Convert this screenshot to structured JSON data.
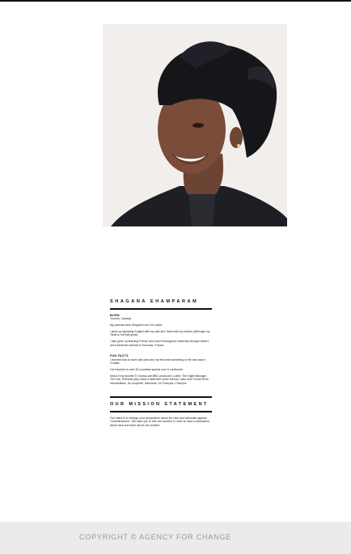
{
  "profile": {
    "name": "SHAGANA EHAMPARAM",
    "born": {
      "label": "BORN",
      "lines": [
        "Toronto, Canada.",
        "My parents were refugees from Sri Lanka.",
        "I grew up speaking English with my dad and Tamil with my mother (although my Tamil is not that great).",
        "I also grew up learning French and took it throughout university through which I did a semester abroad in Toulouse, France."
      ]
    },
    "fun_facts": {
      "label": "FUN FACTS",
      "lines": [
        "I learned how to swim last year and my first time swimming in the sea was in Croatia.",
        "I've traveled to over 30 countries spread over 5 continents.",
        "Most of my favorite TV shows are BBC produced: Luther, The Night Manager, The Fall, Sherlock (also have a detective-crime theme) I also love French films: Intouchables, Un prophète, Welcome, Un Français, Chienpot."
      ]
    }
  },
  "mission": {
    "title": "OUR MISSION STATEMENT",
    "text": "Our intent is to change your perspective about the race and advocate against \"colorblindness\". We want you to see one another in order to have a discussion about race and learn about one another."
  },
  "footer": {
    "copyright": "COPYRIGHT © AGENCY FOR CHANGE"
  },
  "colors": {
    "text": "#111111",
    "footer_bg": "#ebebeb",
    "footer_text": "#9a9a9a"
  }
}
